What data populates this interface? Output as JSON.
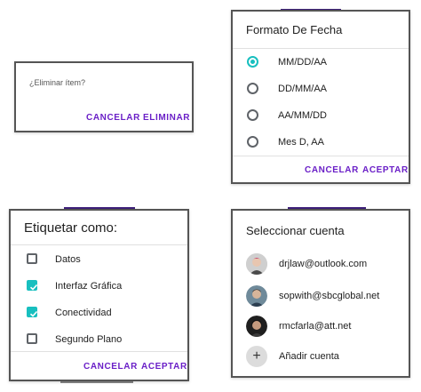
{
  "delete_dialog": {
    "message": "¿Eliminar ítem?",
    "cancel_label": "CANCELAR",
    "delete_label": "ELIMINAR"
  },
  "date_format_dialog": {
    "title": "Formato De Fecha",
    "options": [
      {
        "label": "MM/DD/AA",
        "selected": true
      },
      {
        "label": "DD/MM/AA",
        "selected": false
      },
      {
        "label": "AA/MM/DD",
        "selected": false
      },
      {
        "label": "Mes D, AA",
        "selected": false
      }
    ],
    "cancel_label": "CANCELAR",
    "accept_label": "ACEPTAR"
  },
  "label_dialog": {
    "title": "Etiquetar como:",
    "options": [
      {
        "label": "Datos",
        "checked": false
      },
      {
        "label": "Interfaz Gráfica",
        "checked": true
      },
      {
        "label": "Conectividad",
        "checked": true
      },
      {
        "label": "Segundo Plano",
        "checked": false
      }
    ],
    "cancel_label": "CANCELAR",
    "accept_label": "ACEPTAR"
  },
  "account_dialog": {
    "title": "Seleccionar cuenta",
    "accounts": [
      {
        "email": "drjlaw@outlook.com"
      },
      {
        "email": "sopwith@sbcglobal.net"
      },
      {
        "email": "rmcfarla@att.net"
      }
    ],
    "add_label": "Añadir cuenta",
    "add_icon": "plus-icon"
  },
  "colors": {
    "accent": "#6a1fc7",
    "selection": "#18bfbf"
  }
}
